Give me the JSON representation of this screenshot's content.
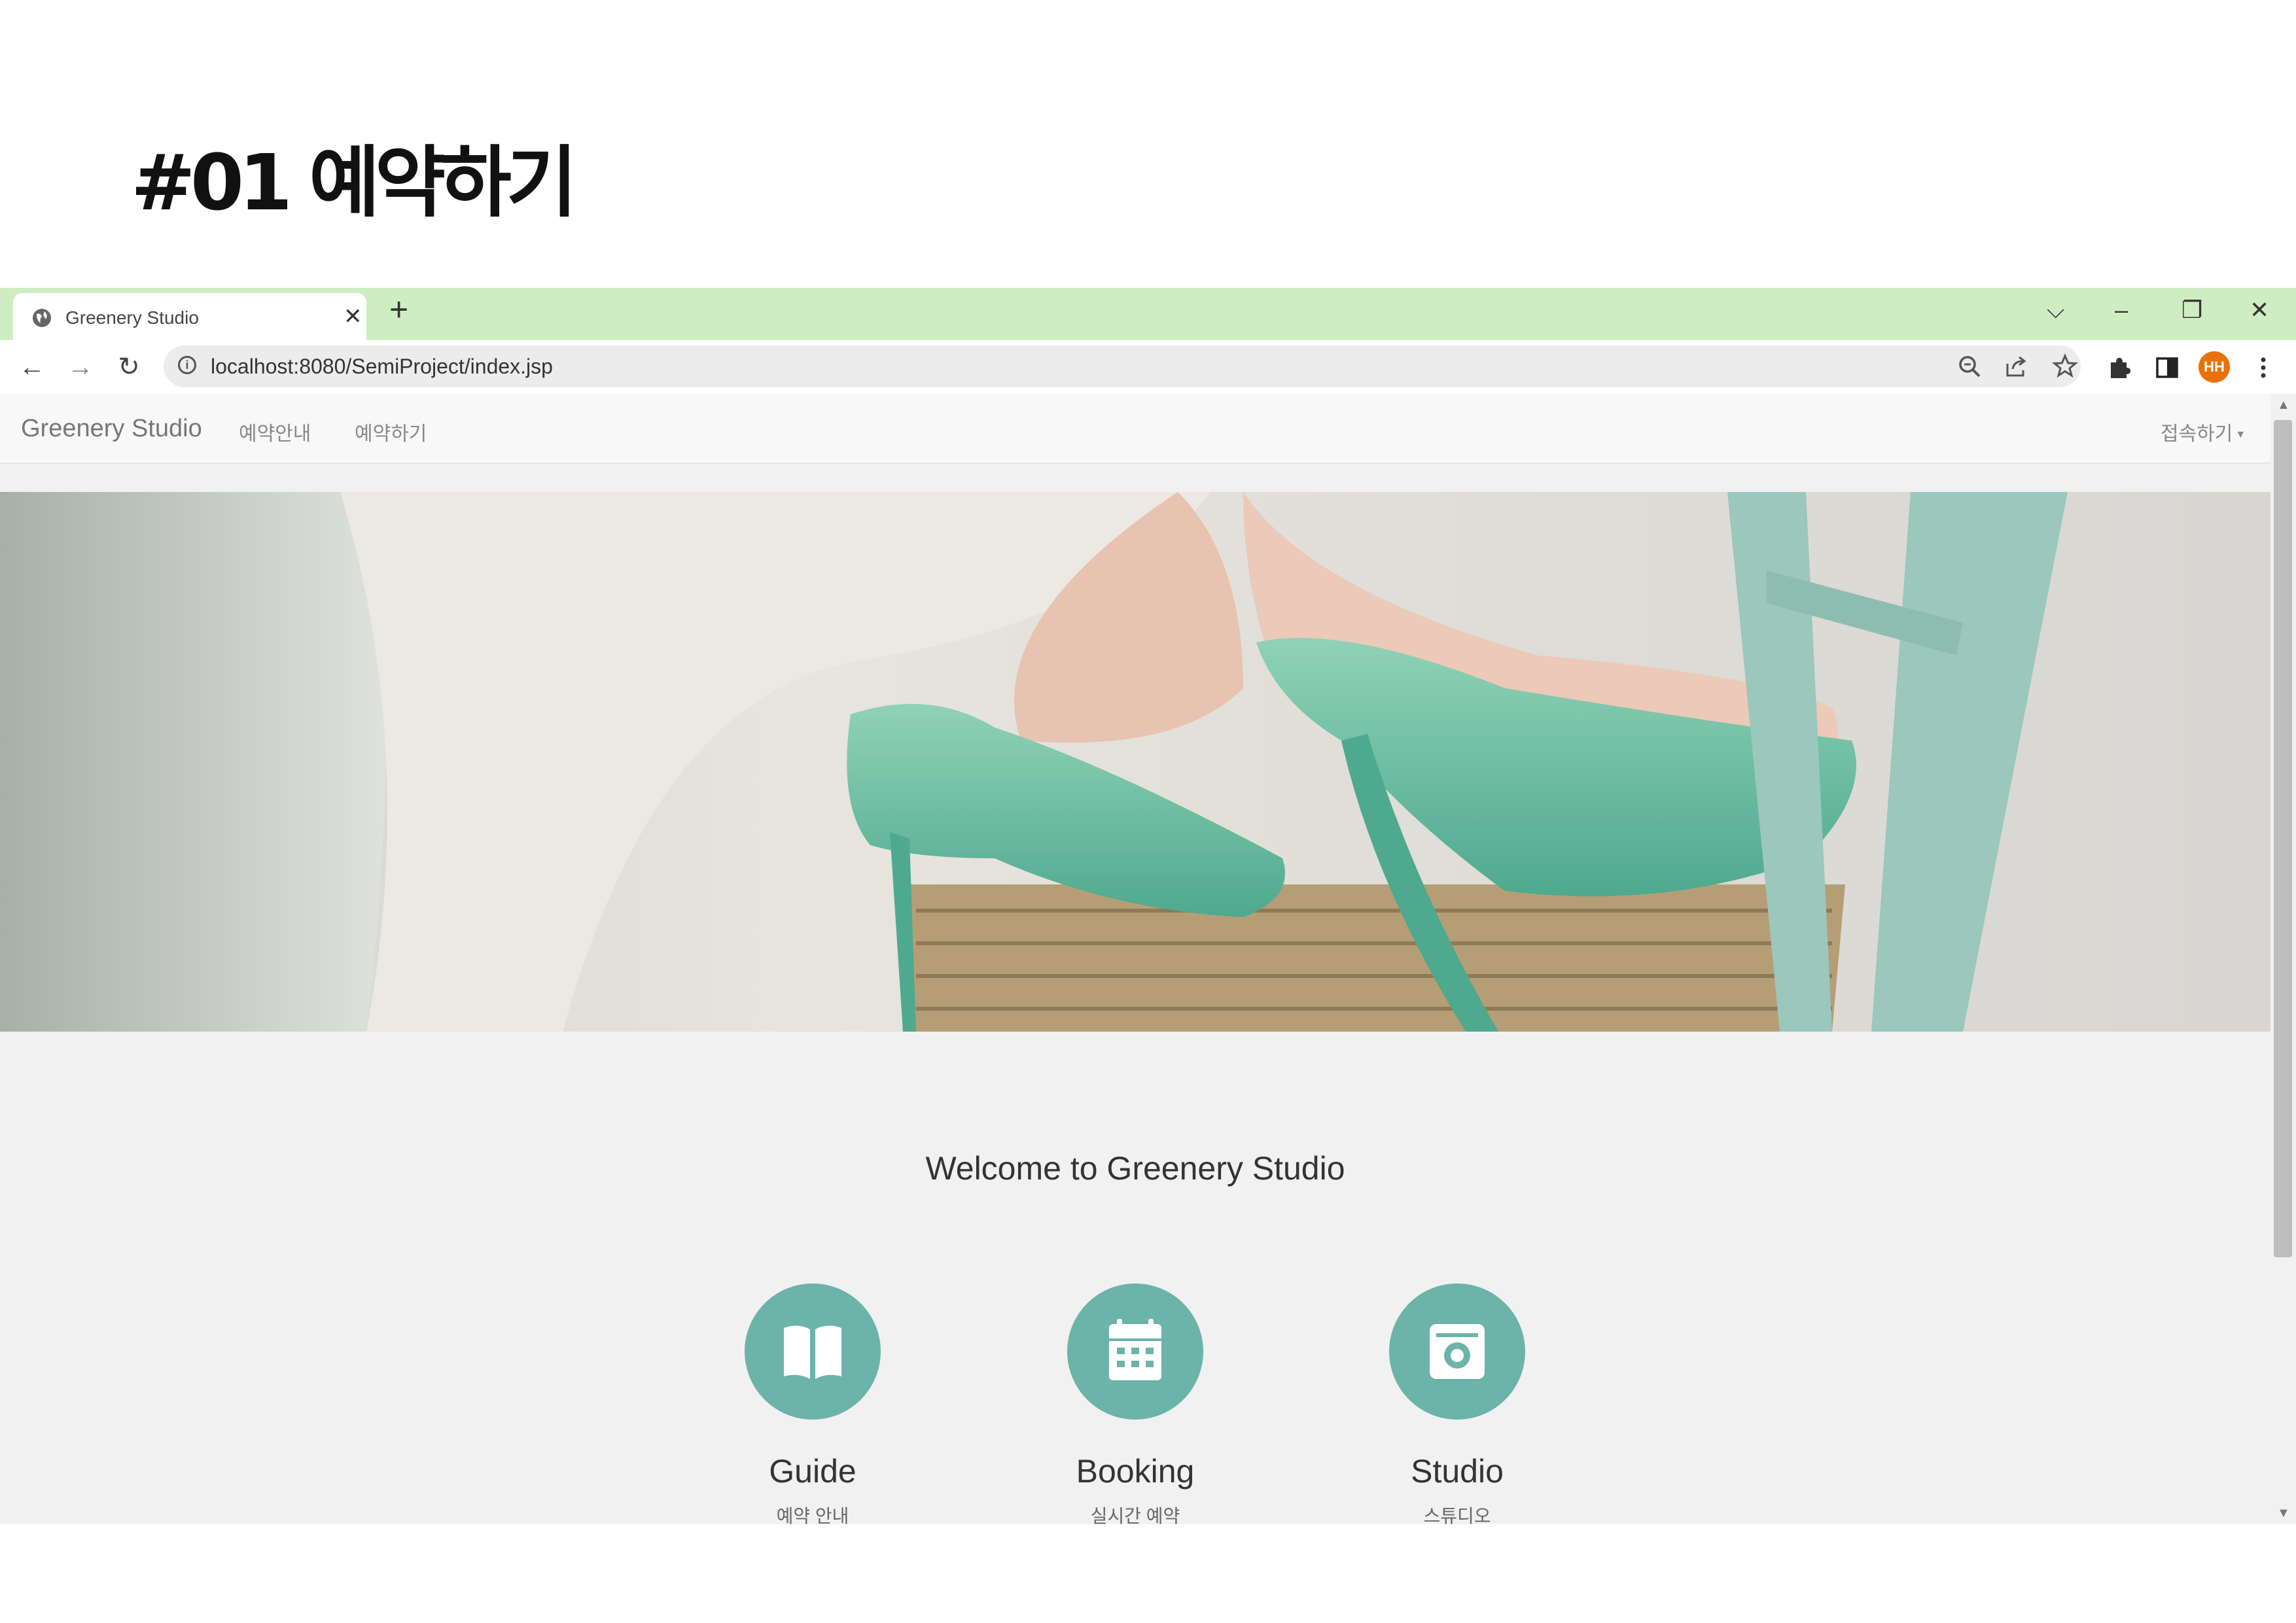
{
  "slide": {
    "title": "#01 예약하기"
  },
  "browser": {
    "tab": {
      "title": "Greenery Studio",
      "close": "✕",
      "new_tab": "+"
    },
    "window_controls": {
      "dropdown": "⌵",
      "minimize": "–",
      "restore": "❐",
      "close": "✕"
    },
    "nav": {
      "back": "←",
      "forward": "→",
      "reload": "↻"
    },
    "address": {
      "url": "localhost:8080/SemiProject/index.jsp"
    },
    "profile": {
      "initials": "HH"
    },
    "icons": [
      "zoom-icon",
      "share-icon",
      "star-icon",
      "extensions-icon",
      "side-panel-icon",
      "menu-icon"
    ]
  },
  "site": {
    "brand": "Greenery Studio",
    "nav_links": [
      "예약안내",
      "예약하기"
    ],
    "nav_right": "접속하기",
    "welcome": "Welcome to Greenery Studio",
    "features": [
      {
        "title": "Guide",
        "subtitle": "예약 안내",
        "icon": "book-icon"
      },
      {
        "title": "Booking",
        "subtitle": "실시간 예약",
        "icon": "calendar-icon"
      },
      {
        "title": "Studio",
        "subtitle": "스튜디오",
        "icon": "camera-icon"
      }
    ]
  },
  "colors": {
    "tabstrip": "#cfedc3",
    "accent": "#6cb3a9",
    "avatar": "#e8710a"
  }
}
